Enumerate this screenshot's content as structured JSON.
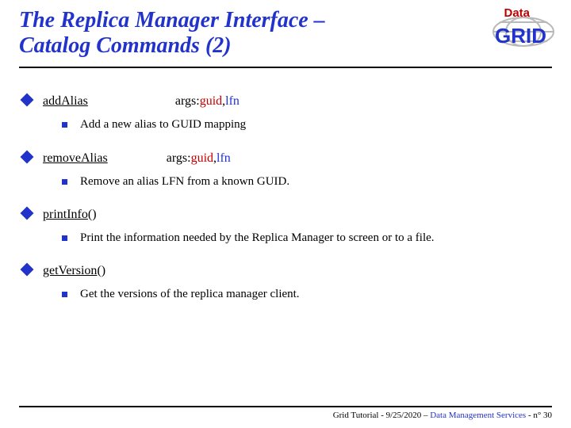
{
  "title_line1": "The Replica Manager Interface –",
  "title_line2": "Catalog Commands (2)",
  "logo": {
    "data_text": "Data",
    "grid_text": "GRID"
  },
  "items": [
    {
      "cmd": "addAlias",
      "args_prefix": "args: ",
      "guid": "guid",
      "sep": ", ",
      "lfn": "lfn",
      "desc": "Add a new alias to GUID mapping"
    },
    {
      "cmd": "removeAlias",
      "args_prefix": "args: ",
      "guid": "guid",
      "sep": ", ",
      "lfn": "lfn",
      "desc": "Remove an alias LFN from a known GUID."
    },
    {
      "cmd": "printInfo",
      "suffix": "()",
      "desc": "Print the information needed by the Replica Manager to screen or to a file."
    },
    {
      "cmd": "getVersion",
      "suffix": "()",
      "desc": "Get the versions of the replica manager client."
    }
  ],
  "footer": {
    "lead": "Grid Tutorial  - 9/25/2020 – ",
    "dms": "Data Management Services",
    "tail": " - n° 30"
  }
}
